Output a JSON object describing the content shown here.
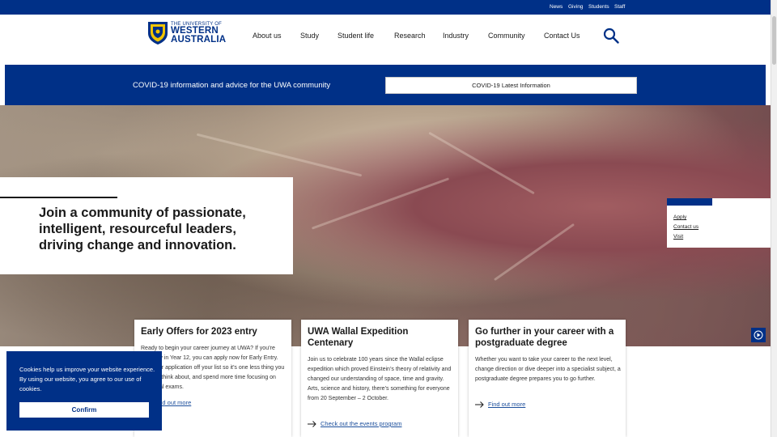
{
  "utility_nav": [
    "News",
    "Giving",
    "Students",
    "Staff"
  ],
  "logo": {
    "line1": "THE UNIVERSITY OF",
    "line2": "WESTERN",
    "line3": "AUSTRALIA"
  },
  "main_nav": [
    "About us",
    "Study",
    "Student life",
    "Research",
    "Industry",
    "Community",
    "Contact Us"
  ],
  "search": {
    "icon": "search-icon"
  },
  "covid": {
    "text": "COVID-19 information and advice for the UWA community",
    "button_label": "COVID-19 Latest Information"
  },
  "hero": {
    "headline": "Join a community of passionate, intelligent, resourceful leaders, driving change and innovation.",
    "video_icon": "play-circle-icon"
  },
  "quick_links": [
    "Apply",
    "Contact us",
    "Visit"
  ],
  "cards": [
    {
      "title": "Early Offers for 2023 entry",
      "body": "Ready to begin your career journey at UWA? If you’re currently in Year 12, you can apply now for Early Entry. Tick your application off your list so it’s one less thing you need to think about, and spend more time focusing on your final exams.",
      "link": "Find out more"
    },
    {
      "title": "UWA Wallal Expedition Centenary",
      "body": "Join us to celebrate 100 years since the Wallal eclipse expedition which proved Einstein’s theory of relativity and changed our understanding of space, time and gravity. Arts, science and history, there’s something for everyone from 20 September – 2 October.",
      "link": "Check out the events program"
    },
    {
      "title": "Go further in your career with a postgraduate degree",
      "body": "Whether you want to take your career to the next level, change direction or dive deeper into a specialist subject, a postgraduate degree prepares you to go further.",
      "link": "Find out more"
    }
  ],
  "cookie": {
    "message": "Cookies help us improve your website experience. By using our website, you agree to our use of cookies.",
    "confirm_label": "Confirm"
  },
  "colors": {
    "brand_blue": "#003087",
    "link_blue": "#1d4f9c",
    "white": "#ffffff"
  }
}
